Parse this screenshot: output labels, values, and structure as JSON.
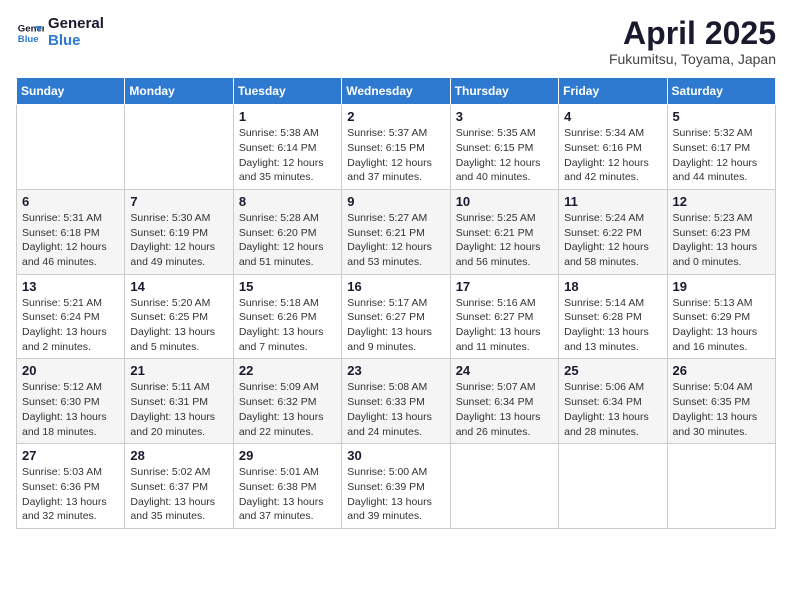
{
  "logo": {
    "line1": "General",
    "line2": "Blue"
  },
  "header": {
    "title": "April 2025",
    "subtitle": "Fukumitsu, Toyama, Japan"
  },
  "weekdays": [
    "Sunday",
    "Monday",
    "Tuesday",
    "Wednesday",
    "Thursday",
    "Friday",
    "Saturday"
  ],
  "weeks": [
    [
      {
        "day": "",
        "info": ""
      },
      {
        "day": "",
        "info": ""
      },
      {
        "day": "1",
        "info": "Sunrise: 5:38 AM\nSunset: 6:14 PM\nDaylight: 12 hours\nand 35 minutes."
      },
      {
        "day": "2",
        "info": "Sunrise: 5:37 AM\nSunset: 6:15 PM\nDaylight: 12 hours\nand 37 minutes."
      },
      {
        "day": "3",
        "info": "Sunrise: 5:35 AM\nSunset: 6:15 PM\nDaylight: 12 hours\nand 40 minutes."
      },
      {
        "day": "4",
        "info": "Sunrise: 5:34 AM\nSunset: 6:16 PM\nDaylight: 12 hours\nand 42 minutes."
      },
      {
        "day": "5",
        "info": "Sunrise: 5:32 AM\nSunset: 6:17 PM\nDaylight: 12 hours\nand 44 minutes."
      }
    ],
    [
      {
        "day": "6",
        "info": "Sunrise: 5:31 AM\nSunset: 6:18 PM\nDaylight: 12 hours\nand 46 minutes."
      },
      {
        "day": "7",
        "info": "Sunrise: 5:30 AM\nSunset: 6:19 PM\nDaylight: 12 hours\nand 49 minutes."
      },
      {
        "day": "8",
        "info": "Sunrise: 5:28 AM\nSunset: 6:20 PM\nDaylight: 12 hours\nand 51 minutes."
      },
      {
        "day": "9",
        "info": "Sunrise: 5:27 AM\nSunset: 6:21 PM\nDaylight: 12 hours\nand 53 minutes."
      },
      {
        "day": "10",
        "info": "Sunrise: 5:25 AM\nSunset: 6:21 PM\nDaylight: 12 hours\nand 56 minutes."
      },
      {
        "day": "11",
        "info": "Sunrise: 5:24 AM\nSunset: 6:22 PM\nDaylight: 12 hours\nand 58 minutes."
      },
      {
        "day": "12",
        "info": "Sunrise: 5:23 AM\nSunset: 6:23 PM\nDaylight: 13 hours\nand 0 minutes."
      }
    ],
    [
      {
        "day": "13",
        "info": "Sunrise: 5:21 AM\nSunset: 6:24 PM\nDaylight: 13 hours\nand 2 minutes."
      },
      {
        "day": "14",
        "info": "Sunrise: 5:20 AM\nSunset: 6:25 PM\nDaylight: 13 hours\nand 5 minutes."
      },
      {
        "day": "15",
        "info": "Sunrise: 5:18 AM\nSunset: 6:26 PM\nDaylight: 13 hours\nand 7 minutes."
      },
      {
        "day": "16",
        "info": "Sunrise: 5:17 AM\nSunset: 6:27 PM\nDaylight: 13 hours\nand 9 minutes."
      },
      {
        "day": "17",
        "info": "Sunrise: 5:16 AM\nSunset: 6:27 PM\nDaylight: 13 hours\nand 11 minutes."
      },
      {
        "day": "18",
        "info": "Sunrise: 5:14 AM\nSunset: 6:28 PM\nDaylight: 13 hours\nand 13 minutes."
      },
      {
        "day": "19",
        "info": "Sunrise: 5:13 AM\nSunset: 6:29 PM\nDaylight: 13 hours\nand 16 minutes."
      }
    ],
    [
      {
        "day": "20",
        "info": "Sunrise: 5:12 AM\nSunset: 6:30 PM\nDaylight: 13 hours\nand 18 minutes."
      },
      {
        "day": "21",
        "info": "Sunrise: 5:11 AM\nSunset: 6:31 PM\nDaylight: 13 hours\nand 20 minutes."
      },
      {
        "day": "22",
        "info": "Sunrise: 5:09 AM\nSunset: 6:32 PM\nDaylight: 13 hours\nand 22 minutes."
      },
      {
        "day": "23",
        "info": "Sunrise: 5:08 AM\nSunset: 6:33 PM\nDaylight: 13 hours\nand 24 minutes."
      },
      {
        "day": "24",
        "info": "Sunrise: 5:07 AM\nSunset: 6:34 PM\nDaylight: 13 hours\nand 26 minutes."
      },
      {
        "day": "25",
        "info": "Sunrise: 5:06 AM\nSunset: 6:34 PM\nDaylight: 13 hours\nand 28 minutes."
      },
      {
        "day": "26",
        "info": "Sunrise: 5:04 AM\nSunset: 6:35 PM\nDaylight: 13 hours\nand 30 minutes."
      }
    ],
    [
      {
        "day": "27",
        "info": "Sunrise: 5:03 AM\nSunset: 6:36 PM\nDaylight: 13 hours\nand 32 minutes."
      },
      {
        "day": "28",
        "info": "Sunrise: 5:02 AM\nSunset: 6:37 PM\nDaylight: 13 hours\nand 35 minutes."
      },
      {
        "day": "29",
        "info": "Sunrise: 5:01 AM\nSunset: 6:38 PM\nDaylight: 13 hours\nand 37 minutes."
      },
      {
        "day": "30",
        "info": "Sunrise: 5:00 AM\nSunset: 6:39 PM\nDaylight: 13 hours\nand 39 minutes."
      },
      {
        "day": "",
        "info": ""
      },
      {
        "day": "",
        "info": ""
      },
      {
        "day": "",
        "info": ""
      }
    ]
  ]
}
